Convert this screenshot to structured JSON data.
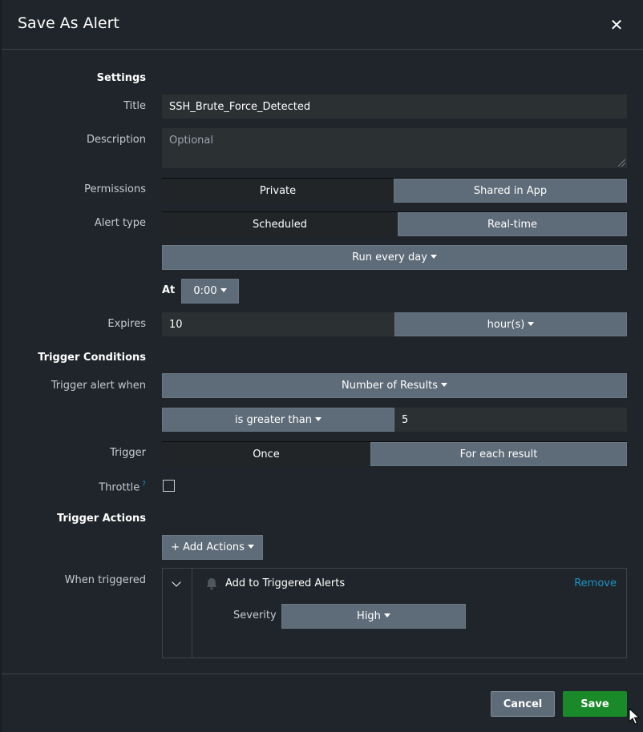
{
  "dialog": {
    "title": "Save As Alert"
  },
  "settings": {
    "heading": "Settings",
    "title_label": "Title",
    "title_value": "SSH_Brute_Force_Detected",
    "description_label": "Description",
    "description_placeholder": "Optional",
    "permissions_label": "Permissions",
    "permissions_options": [
      "Private",
      "Shared in App"
    ],
    "permissions_selected": "Shared in App",
    "alert_type_label": "Alert type",
    "alert_type_options": [
      "Scheduled",
      "Real-time"
    ],
    "alert_type_selected": "Real-time",
    "schedule_value": "Run every day",
    "at_label": "At",
    "at_value": "0:00",
    "expires_label": "Expires",
    "expires_value": "10",
    "expires_unit": "hour(s)"
  },
  "trigger_conditions": {
    "heading": "Trigger Conditions",
    "trigger_when_label": "Trigger alert when",
    "trigger_when_value": "Number of Results",
    "comparator_value": "is greater than",
    "threshold_value": "5",
    "trigger_label": "Trigger",
    "trigger_options": [
      "Once",
      "For each result"
    ],
    "trigger_selected": "For each result",
    "throttle_label": "Throttle",
    "throttle_help": "?",
    "throttle_checked": false
  },
  "trigger_actions": {
    "heading": "Trigger Actions",
    "add_actions_label": "+ Add Actions",
    "when_triggered_label": "When triggered",
    "action": {
      "icon": "bell-icon",
      "name": "Add to Triggered Alerts",
      "remove_label": "Remove",
      "severity_label": "Severity",
      "severity_value": "High"
    }
  },
  "footer": {
    "cancel_label": "Cancel",
    "save_label": "Save"
  },
  "colors": {
    "accent_blue": "#1e93c6",
    "save_green": "#1a8929",
    "selected_button": "#5e6b78"
  }
}
